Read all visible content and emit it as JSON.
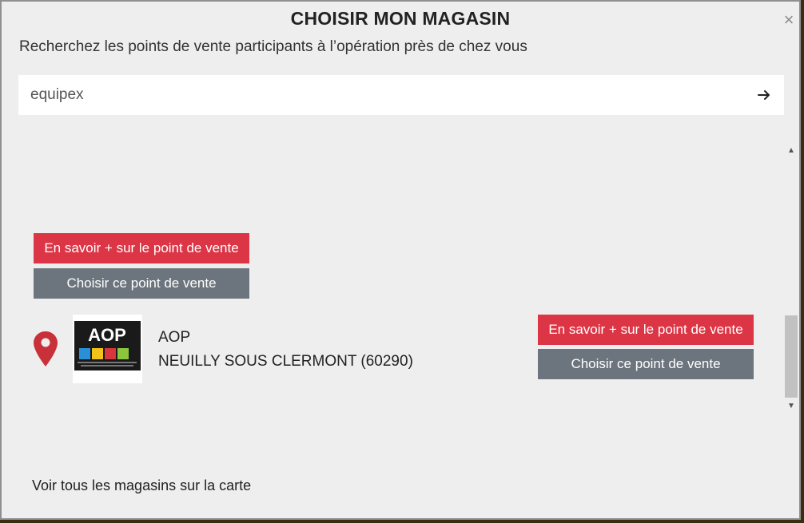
{
  "modal": {
    "title": "CHOISIR MON MAGASIN",
    "close_label": "×",
    "subtitle": "Recherchez les points de vente participants à l’opération près de chez vous"
  },
  "search": {
    "value": "equipex",
    "submit_icon": "arrow-right-icon"
  },
  "results": [
    {
      "learn_more_label": "En savoir + sur le point de vente",
      "choose_label": "Choisir ce point de vente"
    },
    {
      "name": "AOP",
      "city": "NEUILLY SOUS CLERMONT (60290)",
      "logo_text": "AOP",
      "learn_more_label": "En savoir + sur le point de vente",
      "choose_label": "Choisir ce point de vente"
    }
  ],
  "footer": {
    "map_link": "Voir tous les magasins sur la carte"
  },
  "colors": {
    "primary_red": "#dc3545",
    "secondary_gray": "#6c757d",
    "pin_red": "#c8303a"
  }
}
